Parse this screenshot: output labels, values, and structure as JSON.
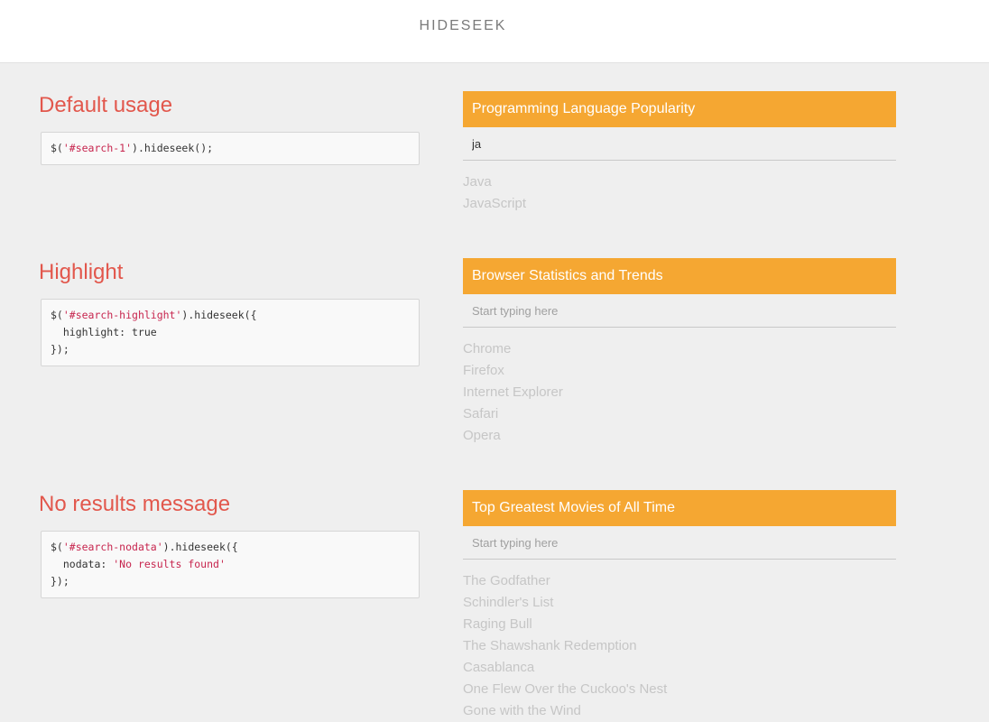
{
  "header": {
    "brand": "HIDESEEK"
  },
  "sections": [
    {
      "title": "Default usage",
      "code": [
        [
          {
            "t": "$("
          },
          {
            "t": "'#search-1'",
            "s": 1
          },
          {
            "t": ").hideseek();"
          }
        ]
      ],
      "panel": {
        "title": "Programming Language Popularity",
        "input_value": "ja",
        "placeholder": "Start typing here",
        "items": [
          "Java",
          "JavaScript"
        ]
      }
    },
    {
      "title": "Highlight",
      "code": [
        [
          {
            "t": "$("
          },
          {
            "t": "'#search-highlight'",
            "s": 1
          },
          {
            "t": ").hideseek({"
          }
        ],
        [
          {
            "t": "  highlight: true"
          }
        ],
        [
          {
            "t": "});"
          }
        ]
      ],
      "panel": {
        "title": "Browser Statistics and Trends",
        "input_value": "",
        "placeholder": "Start typing here",
        "items": [
          "Chrome",
          "Firefox",
          "Internet Explorer",
          "Safari",
          "Opera"
        ]
      }
    },
    {
      "title": "No results message",
      "code": [
        [
          {
            "t": "$("
          },
          {
            "t": "'#search-nodata'",
            "s": 1
          },
          {
            "t": ").hideseek({"
          }
        ],
        [
          {
            "t": "  nodata: "
          },
          {
            "t": "'No results found'",
            "s": 1
          }
        ],
        [
          {
            "t": "});"
          }
        ]
      ],
      "panel": {
        "title": "Top Greatest Movies of All Time",
        "input_value": "",
        "placeholder": "Start typing here",
        "items": [
          "The Godfather",
          "Schindler's List",
          "Raging Bull",
          "The Shawshank Redemption",
          "Casablanca",
          "One Flew Over the Cuckoo's Nest",
          "Gone with the Wind"
        ]
      }
    }
  ],
  "colors": {
    "accent": "#f5a732",
    "title": "#e2574c",
    "code_string": "#c7254e",
    "list_item": "#c6c6c6"
  }
}
